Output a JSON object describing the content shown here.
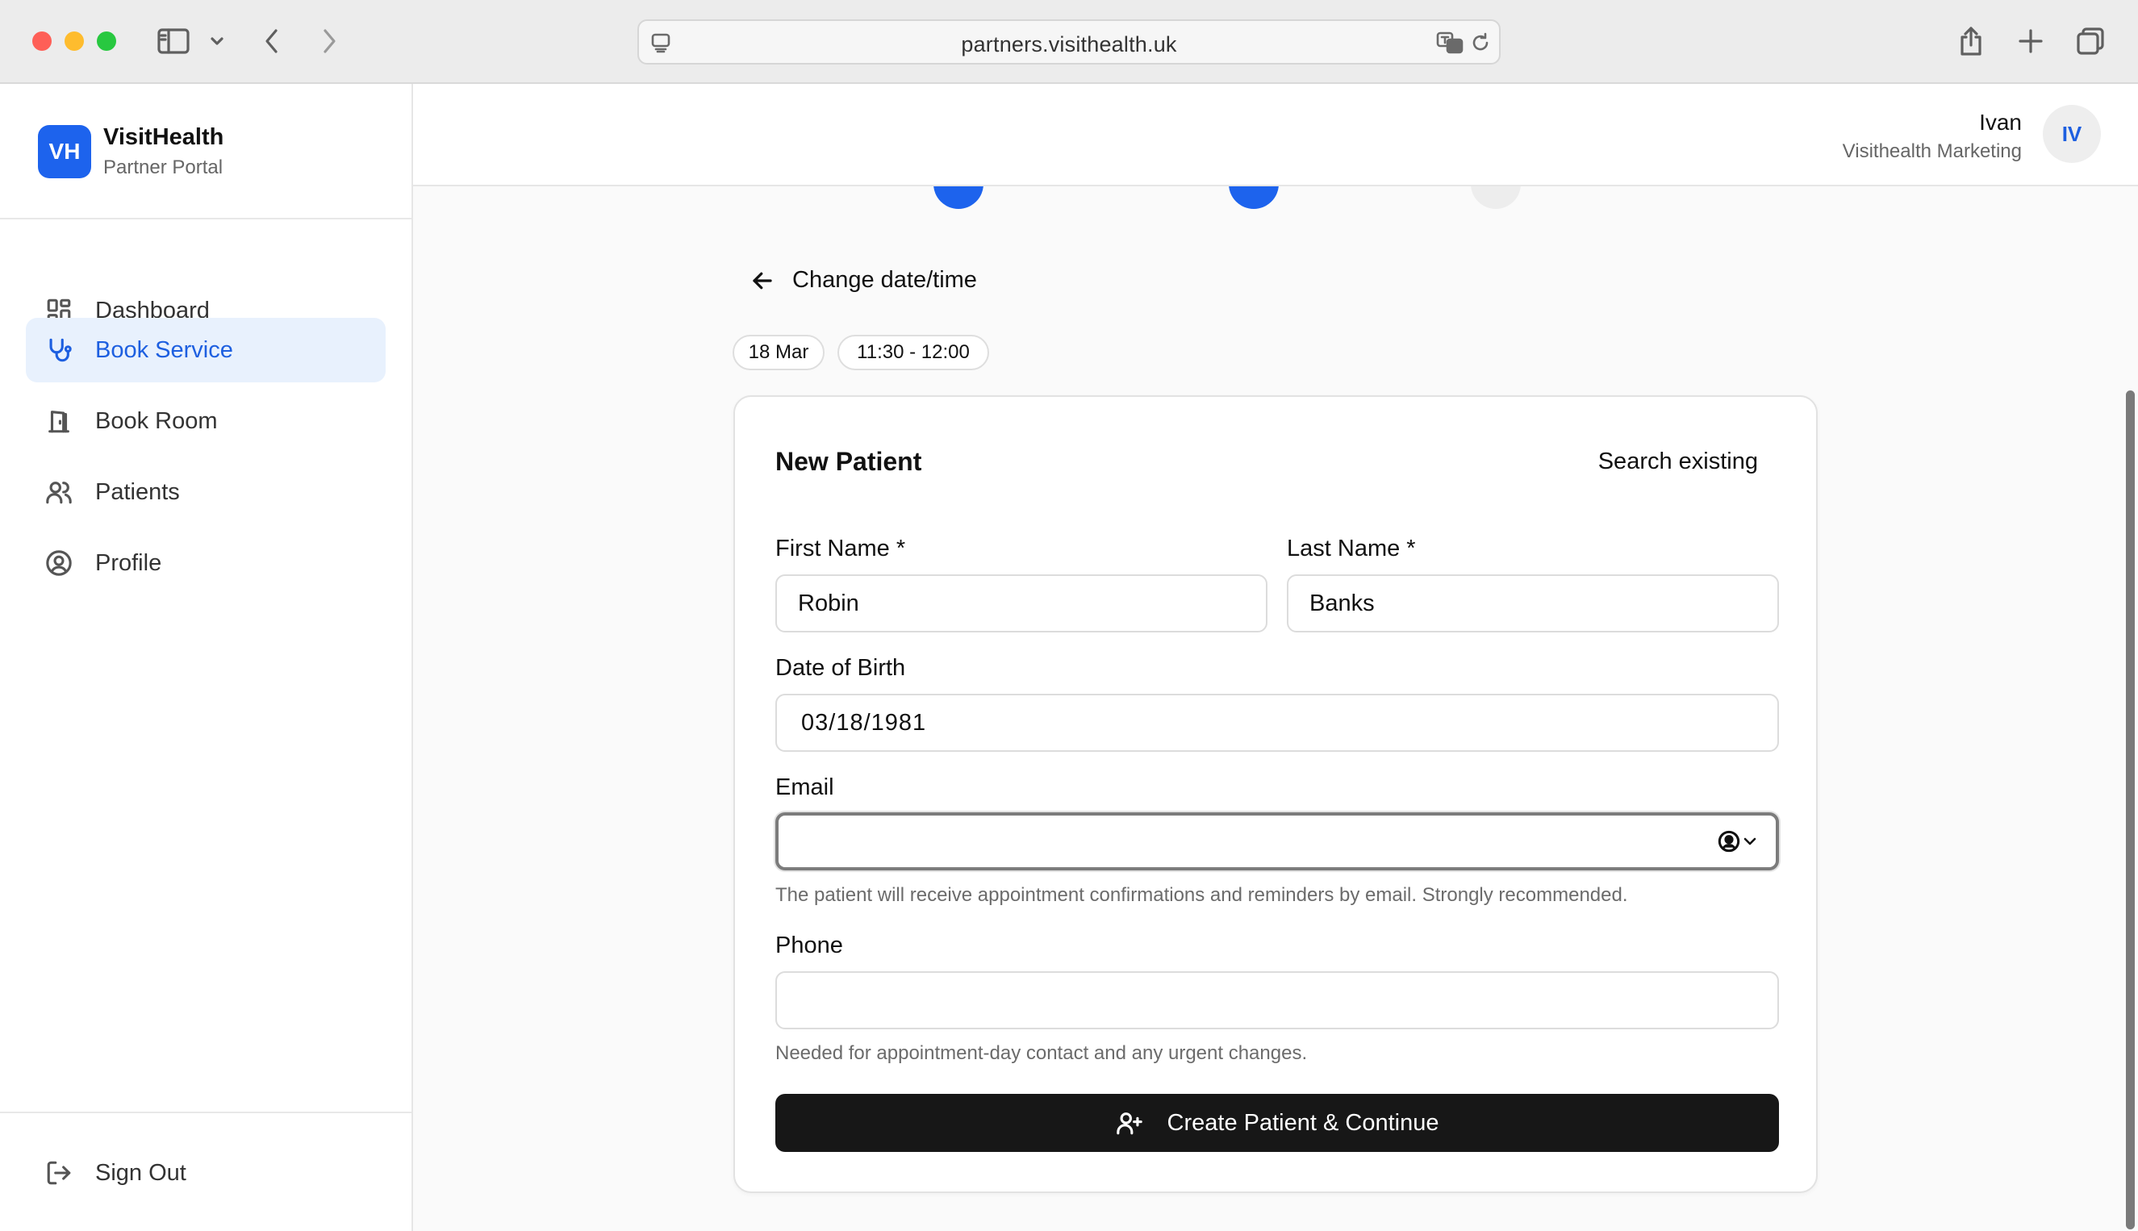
{
  "browser": {
    "url": "partners.visithealth.uk"
  },
  "brand": {
    "logo_initials": "VH",
    "name": "VisitHealth",
    "subtitle": "Partner Portal",
    "accent_color": "#1d63ed"
  },
  "sidebar": {
    "items": [
      {
        "label": "Dashboard",
        "icon": "dashboard-grid-icon",
        "active": false
      },
      {
        "label": "Book Service",
        "icon": "stethoscope-icon",
        "active": true
      },
      {
        "label": "Book Room",
        "icon": "door-icon",
        "active": false
      },
      {
        "label": "Patients",
        "icon": "users-icon",
        "active": false
      },
      {
        "label": "Profile",
        "icon": "user-circle-icon",
        "active": false
      }
    ],
    "sign_out": {
      "label": "Sign Out",
      "icon": "sign-out-icon"
    }
  },
  "header": {
    "user_name": "Ivan",
    "user_org": "Visithealth Marketing",
    "avatar_initials": "IV"
  },
  "stepper": {
    "steps_completed": 2,
    "steps_total": 3
  },
  "booking": {
    "back_label": "Change date/time",
    "date_chip": "18 Mar",
    "time_chip": "11:30 - 12:00"
  },
  "form": {
    "title": "New Patient",
    "search_existing_label": "Search existing",
    "first_name": {
      "label": "First Name *",
      "value": "Robin"
    },
    "last_name": {
      "label": "Last Name *",
      "value": "Banks"
    },
    "dob": {
      "label": "Date of Birth",
      "value": "03/18/1981"
    },
    "email": {
      "label": "Email",
      "value": "",
      "hint": "The patient will receive appointment confirmations and reminders by email. Strongly recommended."
    },
    "phone": {
      "label": "Phone",
      "value": "",
      "hint": "Needed for appointment-day contact and any urgent changes."
    },
    "submit_label": "Create Patient & Continue"
  }
}
